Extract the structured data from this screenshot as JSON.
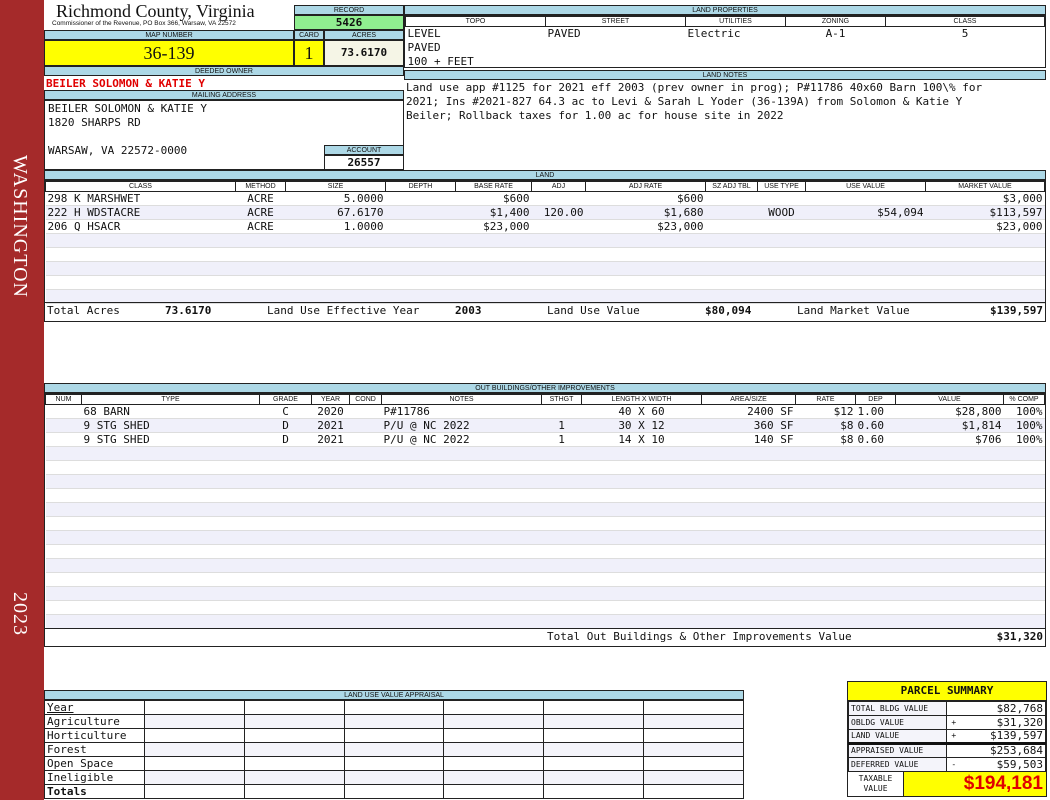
{
  "sidebar": {
    "district": "WASHINGTON",
    "year": "2023",
    "color": "#a52a2a"
  },
  "header": {
    "title": "Richmond County, Virginia",
    "subtitle": "Commissioner of the Revenue, PO Box 366, Warsaw, VA 22572"
  },
  "record": {
    "label": "RECORD",
    "value": "5426"
  },
  "map": {
    "label": "MAP NUMBER",
    "value": "36-139"
  },
  "card": {
    "label": "CARD",
    "value": "1"
  },
  "acres": {
    "label": "ACRES",
    "value": "73.6170"
  },
  "owner": {
    "label": "DEEDED OWNER",
    "value": "BEILER SOLOMON & KATIE Y"
  },
  "mailing": {
    "label": "MAILING ADDRESS",
    "line1": "BEILER SOLOMON & KATIE Y",
    "line2": "1820 SHARPS RD",
    "line3": "WARSAW, VA 22572-0000"
  },
  "account": {
    "label": "ACCOUNT",
    "value": "26557"
  },
  "land_properties": {
    "label": "LAND PROPERTIES",
    "columns": [
      "TOPO",
      "STREET",
      "UTILITIES",
      "ZONING",
      "CLASS"
    ],
    "row1": [
      "LEVEL",
      "PAVED",
      "Electric",
      "A-1",
      "5"
    ],
    "row2": "PAVED",
    "row3": "100 + FEET"
  },
  "land_notes": {
    "label": "LAND NOTES",
    "text": "Land use app #1125 for 2021 eff 2003 (prev owner in prog); P#11786 40x60 Barn 100\\% for 2021; Ins #2021-827 64.3 ac to Levi & Sarah L Yoder (36-139A) from Solomon & Katie Y Beiler; Rollback taxes for 1.00 ac for house site in 2022"
  },
  "land": {
    "label": "LAND",
    "columns": [
      "CLASS",
      "METHOD",
      "SIZE",
      "DEPTH",
      "BASE RATE",
      "ADJ",
      "ADJ RATE",
      "SZ ADJ TBL",
      "USE TYPE",
      "USE VALUE",
      "MARKET VALUE"
    ],
    "rows": [
      [
        "298 K MARSHWET",
        "ACRE",
        "5.0000",
        "",
        "$600",
        "",
        "$600",
        "",
        "",
        "",
        "$3,000"
      ],
      [
        "222 H WDSTACRE",
        "ACRE",
        "67.6170",
        "",
        "$1,400",
        "120.00",
        "$1,680",
        "",
        "WOOD",
        "$54,094",
        "$113,597"
      ],
      [
        "206 Q HSACR",
        "ACRE",
        "1.0000",
        "",
        "$23,000",
        "",
        "$23,000",
        "",
        "",
        "",
        "$23,000"
      ]
    ],
    "totals": {
      "acres_label": "Total Acres",
      "acres": "73.6170",
      "year_label": "Land Use Effective Year",
      "year": "2003",
      "use_label": "Land Use Value",
      "use": "$80,094",
      "market_label": "Land Market Value",
      "market": "$139,597"
    }
  },
  "outbuildings": {
    "label": "OUT BUILDINGS/OTHER IMPROVEMENTS",
    "columns": [
      "NUM",
      "TYPE",
      "GRADE",
      "YEAR",
      "COND",
      "NOTES",
      "STHGT",
      "LENGTH X WIDTH",
      "AREA/SIZE",
      "RATE",
      "DEP",
      "VALUE",
      "% COMP"
    ],
    "rows": [
      [
        "",
        "68 BARN",
        "C",
        "2020",
        "",
        "P#11786",
        "",
        "40 X 60",
        "2400 SF",
        "$12",
        "1.00",
        "$28,800",
        "100%"
      ],
      [
        "",
        "9 STG SHED",
        "D",
        "2021",
        "",
        "P/U @ NC 2022",
        "1",
        "30 X 12",
        "360 SF",
        "$8",
        "0.60",
        "$1,814",
        "100%"
      ],
      [
        "",
        "9 STG SHED",
        "D",
        "2021",
        "",
        "P/U @ NC 2022",
        "1",
        "14 X 10",
        "140 SF",
        "$8",
        "0.60",
        "$706",
        "100%"
      ]
    ],
    "total_label": "Total Out Buildings & Other Improvements Value",
    "total": "$31,320"
  },
  "land_use_appraisal": {
    "label": "LAND USE VALUE APPRAISAL",
    "rows": [
      "Year",
      "Agriculture",
      "Horticulture",
      "Forest",
      "Open Space",
      "Ineligible",
      "Totals"
    ]
  },
  "parcel_summary": {
    "title": "PARCEL SUMMARY",
    "rows": [
      {
        "label": "TOTAL BLDG VALUE",
        "sign": "",
        "value": "$82,768"
      },
      {
        "label": "OBLDG VALUE",
        "sign": "+",
        "value": "$31,320"
      },
      {
        "label": "LAND VALUE",
        "sign": "+",
        "value": "$139,597"
      },
      {
        "label": "APPRAISED VALUE",
        "sign": "",
        "value": "$253,684"
      },
      {
        "label": "DEFERRED VALUE",
        "sign": "-",
        "value": "$59,503"
      }
    ],
    "taxable_label": "TAXABLE VALUE",
    "taxable": "$194,181"
  }
}
